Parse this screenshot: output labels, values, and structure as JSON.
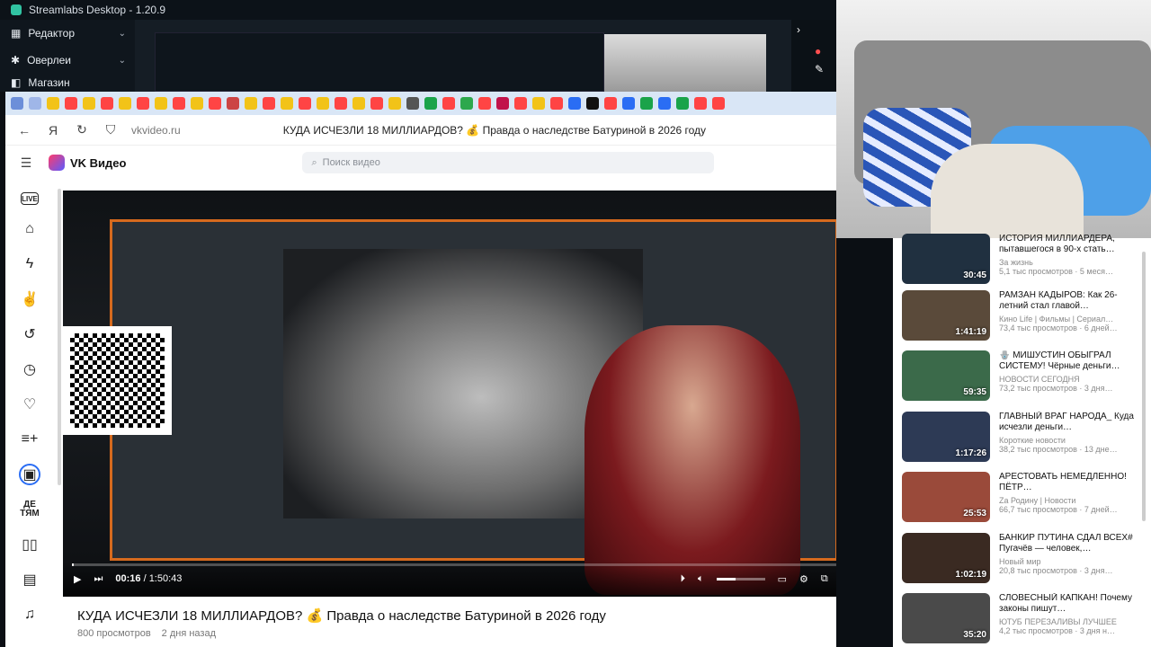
{
  "app": {
    "title": "Streamlabs Desktop - 1.20.9",
    "sidebar": [
      {
        "label": "Редактор"
      },
      {
        "label": "Оверлеи"
      },
      {
        "label": "Магазин"
      }
    ]
  },
  "browser": {
    "url": "vkvideo.ru",
    "page_title": "КУДА ИСЧЕЗЛИ 18 МИЛЛИАРДОВ? 💰 Правда о наследстве Батуриной в 2026 году"
  },
  "vk": {
    "logo": "VK Видео",
    "search_placeholder": "Поиск видео",
    "nav": [
      {
        "icon": "live-icon",
        "label": "LIVE"
      },
      {
        "icon": "home-icon",
        "label": "⌂"
      },
      {
        "icon": "lightning-icon",
        "label": "ϟ"
      },
      {
        "icon": "gesture-icon",
        "label": "✌"
      },
      {
        "icon": "history-icon",
        "label": "↺"
      },
      {
        "icon": "clock-icon",
        "label": "◷"
      },
      {
        "icon": "heart-icon",
        "label": "♡"
      },
      {
        "icon": "playlist-add-icon",
        "label": "≡+"
      },
      {
        "icon": "my-videos-icon",
        "label": "▣"
      },
      {
        "icon": "kids-icon",
        "label": "ДЕ\nТЯМ"
      },
      {
        "icon": "book-icon",
        "label": "▯▯"
      },
      {
        "icon": "shows-icon",
        "label": "▤"
      },
      {
        "icon": "music-icon",
        "label": "♫"
      }
    ]
  },
  "player": {
    "time_current": "00:16",
    "time_total": "1:50:43",
    "progress": 0.0024,
    "volume": 0.4
  },
  "video": {
    "title": "КУДА ИСЧЕЗЛИ 18 МИЛЛИАРДОВ? 💰 Правда о наследстве Батуриной в 2026 году",
    "views": "800 просмотров",
    "age": "2 дня назад"
  },
  "related": [
    {
      "title": "ИСТОРИЯ МИЛЛИАРДЕРА, пытавшегося в 90-х стать…",
      "channel": "За жизнь",
      "stats": "5,1 тыс просмотров · 5 меся…",
      "duration": "30:45",
      "color": "#203040"
    },
    {
      "title": "РАМЗАН КАДЫРОВ: Как 26-летний стал главой…",
      "channel": "Кино Life | Фильмы | Сериал…",
      "stats": "73,4 тыс просмотров · 6 дней…",
      "duration": "1:41:19",
      "color": "#5a4a3a"
    },
    {
      "title": "🪬 МИШУСТИН ОБЫГРАЛ СИСТЕМУ! Чёрные деньги…",
      "channel": "НОВОСТИ СЕГОДНЯ",
      "stats": "73,2 тыс просмотров · 3 дня…",
      "duration": "59:35",
      "color": "#3b6a4a"
    },
    {
      "title": "ГЛАВНЫЙ ВРАГ НАРОДА_ Куда исчезли деньги…",
      "channel": "Короткие новости",
      "stats": "38,2 тыс просмотров · 13 дне…",
      "duration": "1:17:26",
      "color": "#2d3a55"
    },
    {
      "title": "АРЕСТОВАТЬ НЕМЕДЛЕННО! ПЁТР…",
      "channel": "Za Родину | Новости",
      "stats": "66,7 тыс просмотров · 7 дней…",
      "duration": "25:53",
      "color": "#9a4a3a"
    },
    {
      "title": "БАНКИР ПУТИНА СДАЛ ВСЕХ# Пугачёв — человек,…",
      "channel": "Новый мир",
      "stats": "20,8 тыс просмотров · 3 дня…",
      "duration": "1:02:19",
      "color": "#3a2a22"
    },
    {
      "title": "СЛОВЕСНЫЙ КАПКАН! Почему законы пишут…",
      "channel": "ЮТУБ ПЕРЕЗАЛИВЫ ЛУЧШЕЕ",
      "stats": "4,2 тыс просмотров · 3 дня н…",
      "duration": "35:20",
      "color": "#4a4a4a"
    }
  ]
}
